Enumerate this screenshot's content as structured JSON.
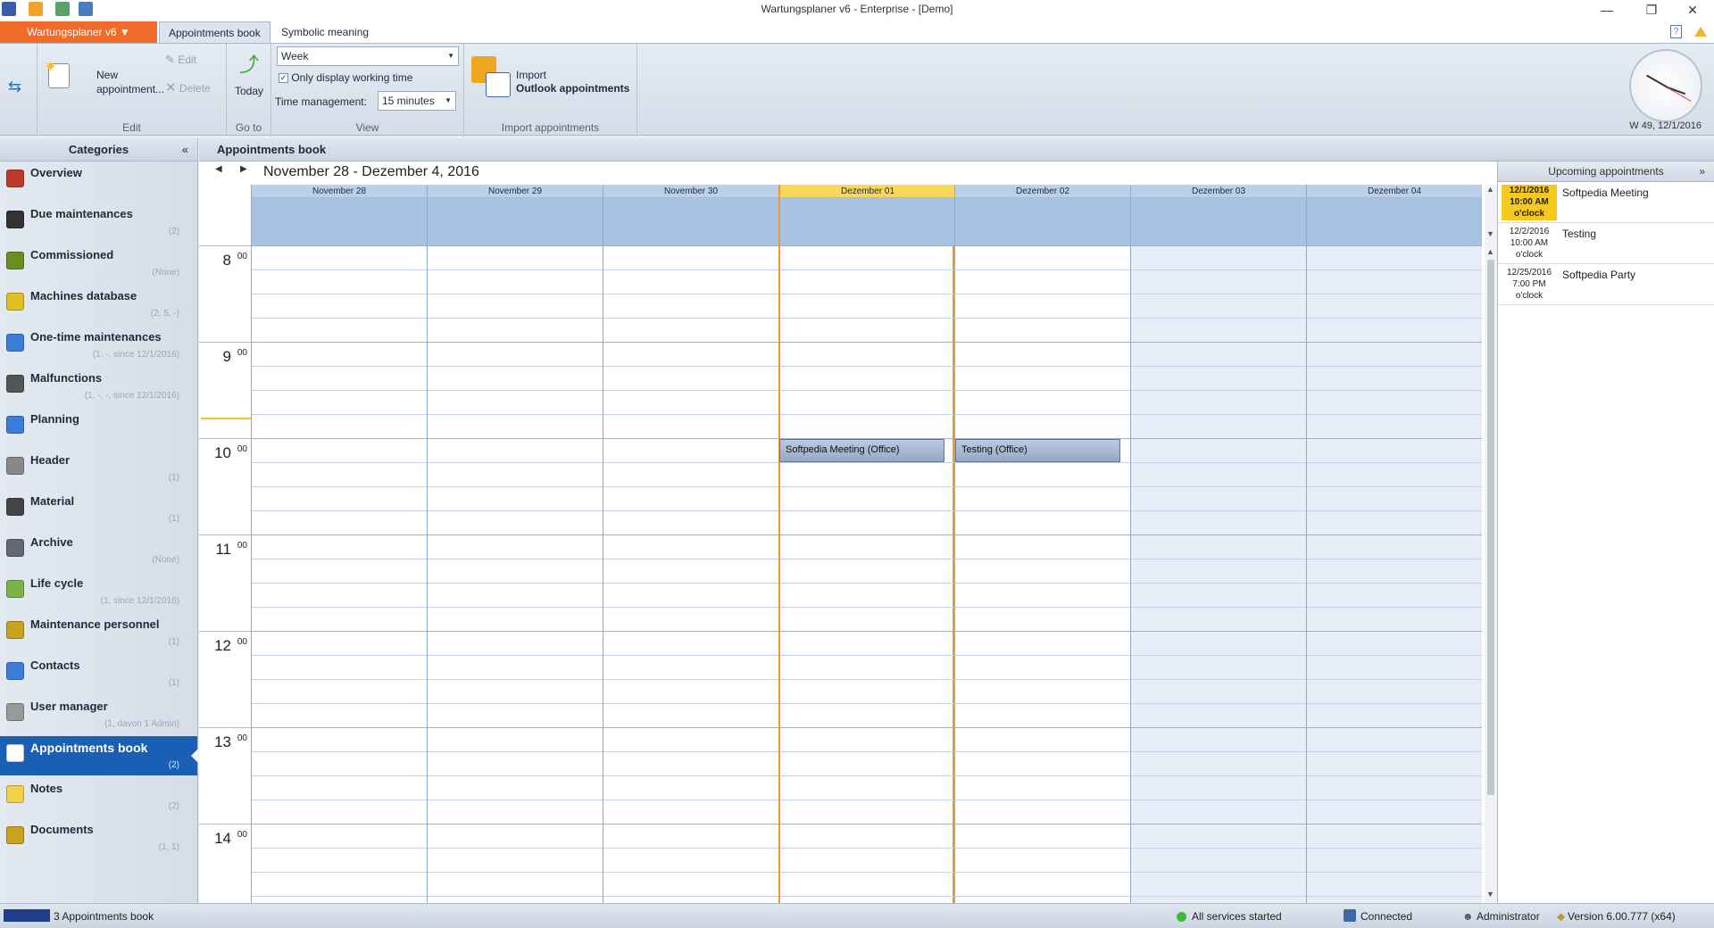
{
  "window": {
    "title": "Wartungsplaner v6 - Enterprise - [Demo]"
  },
  "ribbon": {
    "app_menu_label": "Wartungsplaner v6 ▼",
    "tabs": [
      "Appointments book",
      "Symbolic meaning"
    ],
    "groups": {
      "edit": {
        "label": "Edit",
        "new_label": "New appointment...",
        "edit_label": "Edit",
        "delete_label": "Delete"
      },
      "goto": {
        "label": "Go to",
        "today_label": "Today"
      },
      "view": {
        "label": "View",
        "view_select": "Week",
        "only_working_time": "Only display working time",
        "time_management_label": "Time management:",
        "time_management_value": "15 minutes"
      },
      "import": {
        "label": "Import appointments",
        "line1": "Import",
        "line2": "Outlook appointments"
      }
    },
    "clock_caption": "W 49, 12/1/2016"
  },
  "sidebar": {
    "title": "Categories",
    "collapse_glyph": "«",
    "items": [
      {
        "label": "Overview",
        "sub": ""
      },
      {
        "label": "Due maintenances",
        "sub": "(2)"
      },
      {
        "label": "Commissioned",
        "sub": "(None)"
      },
      {
        "label": "Machines database",
        "sub": "(2, 5, -)"
      },
      {
        "label": "One-time maintenances",
        "sub": "(1, -, since 12/1/2016)"
      },
      {
        "label": "Malfunctions",
        "sub": "(1, -, -, since 12/1/2016)"
      },
      {
        "label": "Planning",
        "sub": ""
      },
      {
        "label": "Header",
        "sub": "(1)"
      },
      {
        "label": "Material",
        "sub": "(1)"
      },
      {
        "label": "Archive",
        "sub": "(None)"
      },
      {
        "label": "Life cycle",
        "sub": "(1, since 12/1/2016)"
      },
      {
        "label": "Maintenance  personnel",
        "sub": "(1)"
      },
      {
        "label": "Contacts",
        "sub": "(1)"
      },
      {
        "label": "User manager",
        "sub": "(1, davon 1 Admin)"
      },
      {
        "label": "Appointments book",
        "sub": "(2)"
      },
      {
        "label": "Notes",
        "sub": "(2)"
      },
      {
        "label": "Documents",
        "sub": "(1, 1)"
      }
    ],
    "active_index": 14
  },
  "main": {
    "title": "Appointments book",
    "date_range": "November 28 - Dezember 4, 2016",
    "prev_glyph": "◀",
    "next_glyph": "▶",
    "days": [
      "November 28",
      "November 29",
      "November 30",
      "Dezember 01",
      "Dezember 02",
      "Dezember 03",
      "Dezember 04"
    ],
    "today_index": 3,
    "weekend_indices": [
      5,
      6
    ],
    "hours": [
      {
        "h": "8",
        "m": "00"
      },
      {
        "h": "9",
        "m": "00"
      },
      {
        "h": "10",
        "m": "00"
      },
      {
        "h": "11",
        "m": "00"
      },
      {
        "h": "12",
        "m": "00"
      },
      {
        "h": "13",
        "m": "00"
      },
      {
        "h": "14",
        "m": "00"
      }
    ],
    "appointments": [
      {
        "text": "Softpedia Meeting (Office)",
        "day": 3
      },
      {
        "text": "Testing (Office)",
        "day": 4
      }
    ]
  },
  "upcoming": {
    "title": "Upcoming appointments",
    "expand_glyph": "»",
    "items": [
      {
        "date": "12/1/2016",
        "time": "10:00 AM",
        "suffix": "o'clock",
        "title": "Softpedia Meeting"
      },
      {
        "date": "12/2/2016",
        "time": "10:00 AM",
        "suffix": "o'clock",
        "title": "Testing"
      },
      {
        "date": "12/25/2016",
        "time": "7:00 PM",
        "suffix": "o'clock",
        "title": "Softpedia Party"
      }
    ]
  },
  "statusbar": {
    "left": "3 Appointments book",
    "services": "All services started",
    "connection": "Connected",
    "user": "Administrator",
    "version": "Version 6.00.777 (x64)"
  }
}
